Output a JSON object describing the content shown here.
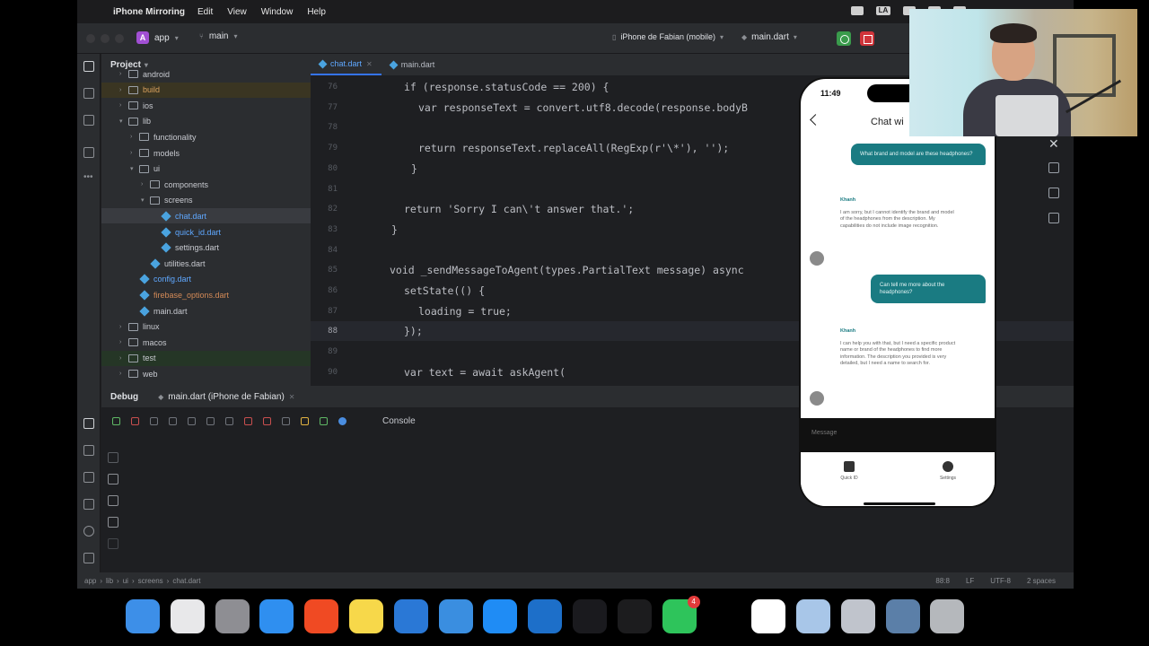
{
  "menubar": {
    "app_name": "iPhone Mirroring",
    "menus": [
      "Edit",
      "View",
      "Window",
      "Help"
    ],
    "input_source": "LA"
  },
  "titlebar": {
    "project": "app",
    "project_badge": "A",
    "branch": "main",
    "device": "iPhone de Fabian (mobile)",
    "run_config": "main.dart"
  },
  "project_panel": {
    "title": "Project",
    "rows": [
      {
        "label": "android",
        "type": "folder",
        "depth": 2,
        "open": false
      },
      {
        "label": "build",
        "type": "folder",
        "depth": 2,
        "open": false
      },
      {
        "label": "ios",
        "type": "folder",
        "depth": 2,
        "open": false
      },
      {
        "label": "lib",
        "type": "folder",
        "depth": 2,
        "open": true
      },
      {
        "label": "functionality",
        "type": "folder",
        "depth": 3,
        "open": false
      },
      {
        "label": "models",
        "type": "folder",
        "depth": 3,
        "open": false
      },
      {
        "label": "ui",
        "type": "folder",
        "depth": 3,
        "open": true
      },
      {
        "label": "components",
        "type": "folder",
        "depth": 4,
        "open": false
      },
      {
        "label": "screens",
        "type": "folder",
        "depth": 4,
        "open": true
      },
      {
        "label": "chat.dart",
        "type": "file",
        "depth": 5
      },
      {
        "label": "quick_id.dart",
        "type": "file",
        "depth": 5
      },
      {
        "label": "settings.dart",
        "type": "file",
        "depth": 5
      },
      {
        "label": "utilities.dart",
        "type": "file",
        "depth": 4
      },
      {
        "label": "config.dart",
        "type": "file",
        "depth": 3
      },
      {
        "label": "firebase_options.dart",
        "type": "file",
        "depth": 3
      },
      {
        "label": "main.dart",
        "type": "file",
        "depth": 3
      },
      {
        "label": "linux",
        "type": "folder",
        "depth": 2,
        "open": false
      },
      {
        "label": "macos",
        "type": "folder",
        "depth": 2,
        "open": false
      },
      {
        "label": "test",
        "type": "folder",
        "depth": 2,
        "open": false
      },
      {
        "label": "web",
        "type": "folder",
        "depth": 2,
        "open": false
      }
    ]
  },
  "editor": {
    "tabs": [
      {
        "label": "chat.dart",
        "active": true
      },
      {
        "label": "main.dart",
        "active": false
      }
    ],
    "lines": [
      {
        "num": "76",
        "text": "if (response.statusCode == 200) {"
      },
      {
        "num": "77",
        "text": "var responseText = convert.utf8.decode(response.bodyB"
      },
      {
        "num": "78",
        "text": ""
      },
      {
        "num": "79",
        "text": "return responseText.replaceAll(RegExp(r'\\*'), '');"
      },
      {
        "num": "80",
        "text": "}"
      },
      {
        "num": "81",
        "text": ""
      },
      {
        "num": "82",
        "text": "return 'Sorry I can\\'t answer that.';"
      },
      {
        "num": "83",
        "text": "}"
      },
      {
        "num": "84",
        "text": ""
      },
      {
        "num": "85",
        "text": "void _sendMessageToAgent(types.PartialText message) async"
      },
      {
        "num": "86",
        "text": "setState(() {"
      },
      {
        "num": "87",
        "text": "loading = true;"
      },
      {
        "num": "88",
        "text": "});"
      },
      {
        "num": "89",
        "text": ""
      },
      {
        "num": "90",
        "text": "var text = await askAgent("
      }
    ]
  },
  "debug": {
    "title": "Debug",
    "session_tab": "main.dart (iPhone de Fabian)",
    "console_label": "Console"
  },
  "statusbar": {
    "crumbs": [
      "app",
      "lib",
      "ui",
      "screens",
      "chat.dart"
    ],
    "position": "88:8",
    "line_sep": "LF",
    "encoding": "UTF-8",
    "indent": "2 spaces"
  },
  "phone": {
    "time": "11:49",
    "chat_title": "Chat wi",
    "messages": [
      {
        "from": "user",
        "text": "What brand and model are these headphones?"
      },
      {
        "from": "agent",
        "author": "Khanh",
        "text": "I am sorry, but I cannot identify the brand and model of the headphones from the description. My capabilities do not include image recognition."
      },
      {
        "from": "user",
        "text": "Can tell me more about the headphones?"
      },
      {
        "from": "agent",
        "author": "Khanh",
        "text": "I can help you with that, but I need a specific product name or brand of the headphones to find more information. The description you provided is very detailed, but I need a name to search for."
      }
    ],
    "input_placeholder": "Message",
    "nav": [
      {
        "label": "Quick ID",
        "icon": "id-card-icon"
      },
      {
        "label": "Settings",
        "icon": "gear-icon"
      }
    ]
  },
  "dock": {
    "apps": [
      {
        "name": "finder-icon",
        "color": "#3d8fe8"
      },
      {
        "name": "launchpad-icon",
        "color": "#e8e8ea"
      },
      {
        "name": "system-settings-icon",
        "color": "#8e8e93"
      },
      {
        "name": "safari-icon",
        "color": "#2f8ff0"
      },
      {
        "name": "brave-icon",
        "color": "#f04a23"
      },
      {
        "name": "notes-icon",
        "color": "#f7d84a"
      },
      {
        "name": "xcode-icon",
        "color": "#2a78d6"
      },
      {
        "name": "simulator-icon",
        "color": "#3a8ee0"
      },
      {
        "name": "app-store-icon",
        "color": "#1f8cf5"
      },
      {
        "name": "vscode-icon",
        "color": "#1d6fc9"
      },
      {
        "name": "intellij-icon",
        "color": "#1a1a1e"
      },
      {
        "name": "terminal-icon",
        "color": "#1c1c1e"
      },
      {
        "name": "whatsapp-icon",
        "color": "#2ec45b",
        "badge": "4"
      },
      {
        "name": "visual-studio-icon",
        "color": "#000000"
      },
      {
        "name": "arc-icon",
        "color": "#ffffff"
      },
      {
        "name": "preview-icon",
        "color": "#a8c6e8"
      },
      {
        "name": "iphone-mirroring-icon",
        "color": "#c0c4cc"
      },
      {
        "name": "downloads-icon",
        "color": "#5b7fa8"
      },
      {
        "name": "trash-icon",
        "color": "#b5b8bc"
      }
    ]
  }
}
